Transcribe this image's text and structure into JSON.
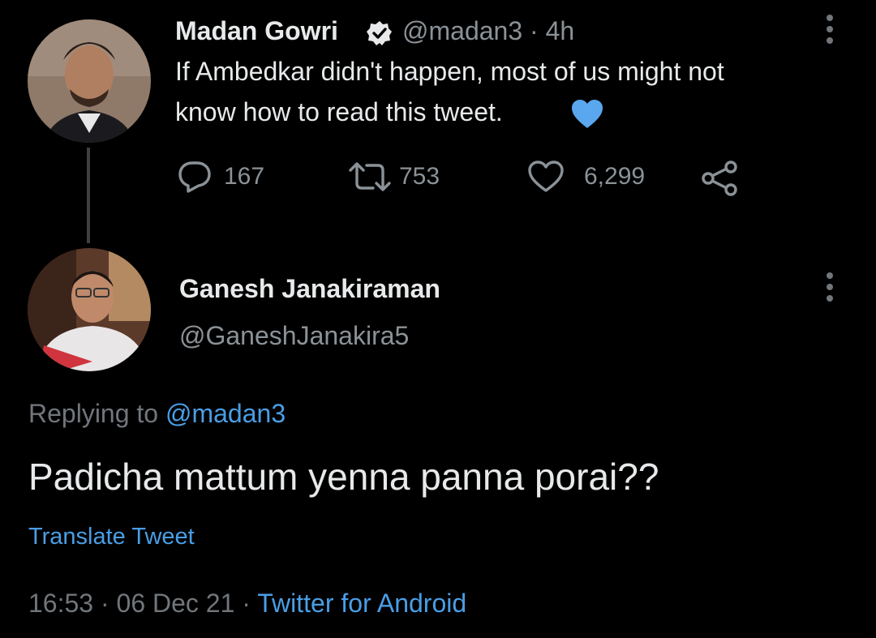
{
  "original_tweet": {
    "author_name": "Madan Gowri",
    "verified": true,
    "handle": "@madan3",
    "separator": "·",
    "age": "4h",
    "text_line1": "If Ambedkar didn't happen, most of us might not",
    "text_line2": "know how to read this tweet.",
    "emoji": "blue-heart",
    "replies": "167",
    "retweets": "753",
    "likes": "6,299"
  },
  "reply_tweet": {
    "author_name": "Ganesh Janakiraman",
    "handle": "@GaneshJanakira5",
    "replying_prefix": "Replying to",
    "replying_handle": "@madan3",
    "text": "Padicha mattum yenna panna porai??",
    "translate_label": "Translate Tweet",
    "time": "16:53",
    "date": "06 Dec 21",
    "separator": "·",
    "source": "Twitter for Android"
  },
  "colors": {
    "background": "#000000",
    "text": "#e7e9ea",
    "muted": "#71767b",
    "link": "#4a9ee5",
    "heart": "#5aa7ef"
  }
}
